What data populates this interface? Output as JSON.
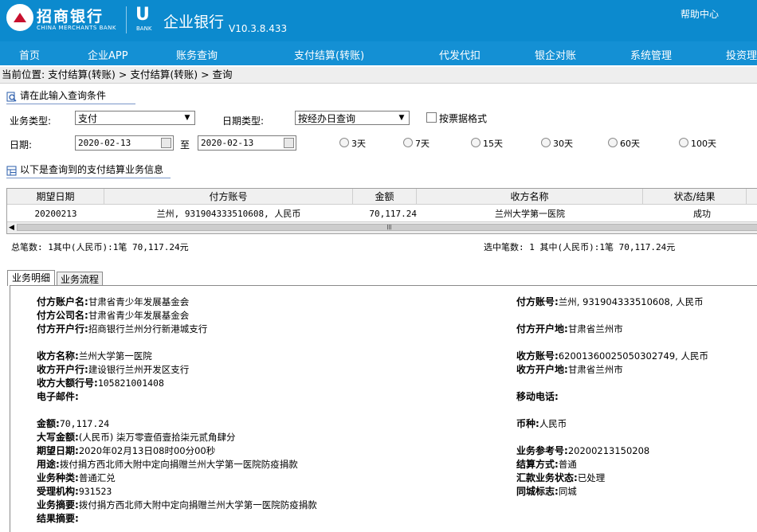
{
  "header": {
    "bank_name_cn": "招商银行",
    "bank_name_en": "CHINA MERCHANTS BANK",
    "bank_brand_mark": "U",
    "bank_brand_en": "BANK",
    "product_title": "企业银行",
    "version": "V10.3.8.433",
    "help_link": "帮助中心"
  },
  "nav": {
    "items": [
      {
        "label": "首页"
      },
      {
        "label": "企业APP"
      },
      {
        "label": "账务查询"
      },
      {
        "label": "支付结算(转账)"
      },
      {
        "label": "代发代扣"
      },
      {
        "label": "银企对账"
      },
      {
        "label": "系统管理"
      },
      {
        "label": "投资理"
      }
    ]
  },
  "breadcrumb": "当前位置: 支付结算(转账) > 支付结算(转账) > 查询",
  "query": {
    "section_title": "请在此输入查询条件",
    "business_type_label": "业务类型:",
    "business_type_value": "支付",
    "date_type_label": "日期类型:",
    "date_type_value": "按经办日查询",
    "bill_format_label": "按票据格式",
    "date_label": "日期:",
    "date_from": "2020-02-13",
    "to_label": "至",
    "date_to": "2020-02-13",
    "range_options": [
      "3天",
      "7天",
      "15天",
      "30天",
      "60天",
      "100天"
    ]
  },
  "results": {
    "section_title": "以下是查询到的支付结算业务信息",
    "columns": [
      "期望日期",
      "付方账号",
      "金额",
      "收方名称",
      "状态/结果"
    ],
    "rows": [
      {
        "date": "20200213",
        "payer_account": "兰州, 931904333510608, 人民币",
        "amount": "70,117.24",
        "payee_name": "兰州大学第一医院",
        "status": "成功"
      }
    ],
    "scroll_grip": "|||",
    "summary_total": "总笔数: 1其中(人民币):1笔  70,117.24元",
    "summary_selected": "选中笔数: 1 其中(人民币):1笔  70,117.24元"
  },
  "tabs": [
    "业务明细",
    "业务流程"
  ],
  "detail": {
    "payer_account_name": {
      "label": "付方账户名:",
      "value": "甘肃省青少年发展基金会"
    },
    "payer_company_name": {
      "label": "付方公司名:",
      "value": "甘肃省青少年发展基金会"
    },
    "payer_bank": {
      "label": "付方开户行:",
      "value": "招商银行兰州分行新港城支行"
    },
    "payer_account_no": {
      "label": "付方账号:",
      "value": "兰州, 931904333510608, 人民币"
    },
    "payer_location": {
      "label": "付方开户地:",
      "value": "甘肃省兰州市"
    },
    "payee_name": {
      "label": "收方名称:",
      "value": "兰州大学第一医院"
    },
    "payee_bank": {
      "label": "收方开户行:",
      "value": "建设银行兰州开发区支行"
    },
    "payee_large_bank_no": {
      "label": "收方大额行号:",
      "value": "105821001408"
    },
    "email": {
      "label": "电子邮件:",
      "value": ""
    },
    "payee_account_no": {
      "label": "收方账号:",
      "value": "62001360025050302749, 人民币"
    },
    "payee_location": {
      "label": "收方开户地:",
      "value": "甘肃省兰州市"
    },
    "mobile": {
      "label": "移动电话:",
      "value": ""
    },
    "amount": {
      "label": "金额:",
      "value": "70,117.24"
    },
    "amount_upper": {
      "label": "大写金额:",
      "value": "(人民币) 柒万零壹佰壹拾柒元贰角肆分"
    },
    "expected_date": {
      "label": "期望日期:",
      "value": "2020年02月13日08时00分00秒"
    },
    "purpose": {
      "label": "用途:",
      "value": "拨付捐方西北师大附中定向捐赠兰州大学第一医院防疫捐款"
    },
    "business_category": {
      "label": "业务种类:",
      "value": "普通汇兑"
    },
    "accepting_org": {
      "label": "受理机构:",
      "value": "931523"
    },
    "business_summary": {
      "label": "业务摘要:",
      "value": "拨付捐方西北师大附中定向捐赠兰州大学第一医院防疫捐款"
    },
    "result_summary": {
      "label": "结果摘要:",
      "value": ""
    },
    "currency": {
      "label": "币种:",
      "value": "人民币"
    },
    "reference_no": {
      "label": "业务参考号:",
      "value": "20200213150208"
    },
    "settlement_method": {
      "label": "结算方式:",
      "value": "普通"
    },
    "remittance_status": {
      "label": "汇款业务状态:",
      "value": "已处理"
    },
    "same_city_flag": {
      "label": "同城标志:",
      "value": "同城"
    }
  },
  "colors": {
    "header_bg": "#0c8ace",
    "nav_bg": "#1490d4",
    "logo_red": "#c8102e"
  }
}
